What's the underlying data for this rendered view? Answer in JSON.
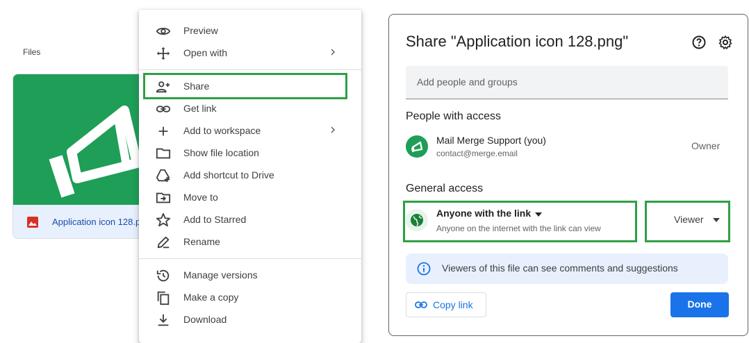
{
  "files_panel": {
    "label": "Files",
    "file_name": "Application icon 128.p",
    "file_type_icon": "image-file-icon",
    "thumbnail_color": "#1e9e57"
  },
  "context_menu": {
    "items": [
      {
        "label": "Preview",
        "icon": "eye-icon"
      },
      {
        "label": "Open with",
        "icon": "move-arrows-icon",
        "submenu": true
      },
      {
        "label": "Share",
        "icon": "person-add-icon",
        "highlighted": true
      },
      {
        "label": "Get link",
        "icon": "link-icon"
      },
      {
        "label": "Add to workspace",
        "icon": "plus-icon",
        "submenu": true
      },
      {
        "label": "Show file location",
        "icon": "folder-icon"
      },
      {
        "label": "Add shortcut to Drive",
        "icon": "drive-shortcut-icon"
      },
      {
        "label": "Move to",
        "icon": "move-to-folder-icon"
      },
      {
        "label": "Add to Starred",
        "icon": "star-icon"
      },
      {
        "label": "Rename",
        "icon": "pencil-icon"
      },
      {
        "label": "Manage versions",
        "icon": "history-icon"
      },
      {
        "label": "Make a copy",
        "icon": "copy-icon"
      },
      {
        "label": "Download",
        "icon": "download-icon"
      }
    ]
  },
  "share_dialog": {
    "title": "Share \"Application icon 128.png\"",
    "add_people_placeholder": "Add people and groups",
    "people_heading": "People with access",
    "person": {
      "name": "Mail Merge Support (you)",
      "email": "contact@merge.email",
      "role": "Owner"
    },
    "general_heading": "General access",
    "access": {
      "title": "Anyone with the link",
      "description": "Anyone on the internet with the link can view",
      "role": "Viewer"
    },
    "info_text": "Viewers of this file can see comments and suggestions",
    "copy_link_label": "Copy link",
    "done_label": "Done",
    "colors": {
      "accent": "#1a73e8",
      "highlight": "#2ea043",
      "info_bg": "#e8f0fe"
    }
  }
}
